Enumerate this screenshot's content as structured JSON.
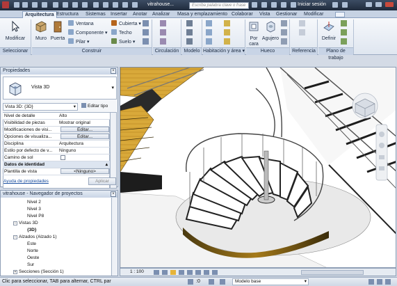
{
  "titlebar": {
    "doc_title": "vitrahouse...",
    "search_placeholder": "Escriba palabra clave o frase",
    "signin_label": "Iniciar sesión"
  },
  "tabs": [
    "Arquitectura",
    "Estructura",
    "Sistemas",
    "Insertar",
    "Anotar",
    "Analizar",
    "Masa y emplazamiento",
    "Colaborar",
    "Vista",
    "Gestionar",
    "Modificar"
  ],
  "ribbon": {
    "modificar": "Modificar",
    "muro": "Muro",
    "puerta": "Puerta",
    "ventana": "Ventana",
    "componente": "Componente",
    "pilar": "Pilar",
    "cubierta": "Cubierta",
    "techo": "Techo",
    "suelo": "Suelo",
    "por_cara": "Por\ncara",
    "agujero": "Agujero",
    "definir": "Definir",
    "panels": {
      "seleccionar": "Seleccionar",
      "construir": "Construir",
      "circulacion": "Circulación",
      "modelo": "Modelo",
      "habitacion": "Habitación y área",
      "hueco": "Hueco",
      "referencia": "Referencia",
      "plano": "Plano de trabajo"
    }
  },
  "properties": {
    "title": "Propiedades",
    "type_name": "Vista 3D",
    "instance_selector": "Vista 3D: {3D}",
    "edit_type": "Editar tipo",
    "rows": [
      {
        "key": "Nivel de detalle",
        "value": "Alto"
      },
      {
        "key": "Visibilidad de piezas",
        "value": "Mostrar original"
      },
      {
        "key": "Modificaciones de visi...",
        "value": "Editar..."
      },
      {
        "key": "Opciones de visualiza...",
        "value": "Editar..."
      },
      {
        "key": "Disciplina",
        "value": "Arquitectura"
      },
      {
        "key": "Estilo por defecto de v...",
        "value": "Ninguno"
      },
      {
        "key": "Camino de sol",
        "value": ""
      }
    ],
    "group_identity": "Datos de identidad",
    "template_key": "Plantilla de vista",
    "template_value": "<Ninguno>",
    "help_link": "Ayuda de propiedades",
    "apply": "Aplicar"
  },
  "browser": {
    "title": "vitrahouse - Navegador de proyectos",
    "nodes": [
      "Nivel 2",
      "Nivel 3",
      "Nivel P8",
      "Vistas 3D",
      "{3D}",
      "Alzados (Alzado 1)",
      "Este",
      "Norte",
      "Oeste",
      "Sur",
      "Secciones (Sección 1)"
    ]
  },
  "viewbar": {
    "scale": "1 : 100"
  },
  "status": {
    "message": "Clic para seleccionar, TAB para alternar, CTRL par",
    "counter": ":0",
    "model": "Modelo base"
  }
}
